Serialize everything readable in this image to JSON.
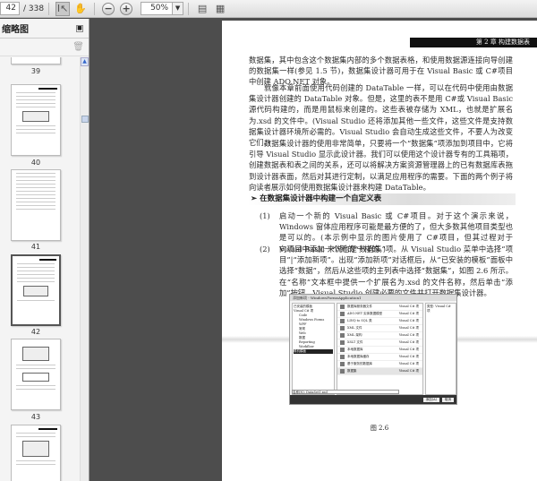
{
  "toolbar": {
    "page_current": "42",
    "page_total": "/ 338",
    "zoom": "50%",
    "icons": [
      "select-tool-icon",
      "hand-tool-icon",
      "zoom-out-icon",
      "zoom-in-icon",
      "fit-page-icon",
      "fit-width-icon"
    ]
  },
  "sidebar": {
    "title": "缩略图",
    "thumbnails": [
      {
        "label": "39"
      },
      {
        "label": "40"
      },
      {
        "label": "41"
      },
      {
        "label": "42"
      },
      {
        "label": "43"
      }
    ]
  },
  "page": {
    "header": "第 2 章  构建数据表",
    "para1": "数据集，其中包含这个数据集内部的多个数据表格，和使用数据源连接向导创建的数据集一样(参见 1.5 节)，数据集设计器可用于在 Visual Basic 或 C#项目中创建 ADO.NET 对象。",
    "para2": "就像本章前面使用代码创建的 DataTable 一样，可以在代码中使用由数据集设计器创建的 DataTable 对象。但是，这里的表不是用 C#或 Visual Basic 源代码构建的，而是用鼠标来创建的。这些表被存储为 XML，也就是扩展名为.xsd 的文件中。(Visual Studio 还将添加其他一些文件，这些文件是支持数据集设计器环境所必需的。Visual Studio 会自动生成这些文件，不要人为改变它们。)",
    "para3": "数据集设计器的使用非常简单，只要将一个“数据集”项添加到项目中，它将引导 Visual Studio 显示此设计器。我们可以使用这个设计器专有的工具箱项，创建数据表和表之间的关系，还可以将解决方案资源管理器上的已有数据库表拖到设计器表面，然后对其进行定制，以满足应用程序的需要。下面的两个例子将向读者展示如何使用数据集设计器来构建 DataTable。",
    "heading": "➢   在数据集设计器中构建一个自定义表",
    "steps": [
      {
        "num": "(1)",
        "text": "启动一个新的 Visual Basic 或 C#项目。对于这个演示来说，Windows 窗体应用程序可能是最方便的了，但大多数其他项目类型也是可以的。(本示例中显示的图片使用了 C#项目，但其过程对于 Visual Basic 来说也是一样的。)"
      },
      {
        "num": "(2)",
        "text": "向项目中添加一个新的“数据集”项。从 Visual Studio 菜单中选择“项目”|“添加新项”。出现“添加新项”对话框后，从“已安装的模板”面板中选择“数据”，然后从这些项的主列表中选择“数据集”，如图 2.6 所示。在“名称”文本框中提供一个扩展名为.xsd 的文件名称，然后单击“添加”按钮。Visual Studio 创建必要的文件并打开数据集设计器。"
      }
    ],
    "figure": {
      "title": "添加新项 - WindowsFormsApplication1",
      "left_items": [
        "已安装的模板",
        "Visual C# 项",
        "Code",
        "Windows Forms",
        "WPF",
        "常规",
        "Web",
        "数据",
        "Reporting",
        "Workflow",
        "联机模板"
      ],
      "selected_left": "数据",
      "items": [
        "数据库服务器文件",
        "ADO.NET 实体数据模型",
        "LINQ to SQL 类",
        "XML 文件",
        "XML 架构",
        "XSLT 文件",
        "本地数据库",
        "本地数据库缓存",
        "基于服务的数据库",
        "数据集"
      ],
      "item_type": "Visual C# 项",
      "right_text": "类型: Visual C# 项",
      "name_label": "名称(N):",
      "name_value": "DataSet1.xsd",
      "add_button": "添加(A)",
      "cancel_button": "取消"
    },
    "caption": "图 2.6"
  }
}
